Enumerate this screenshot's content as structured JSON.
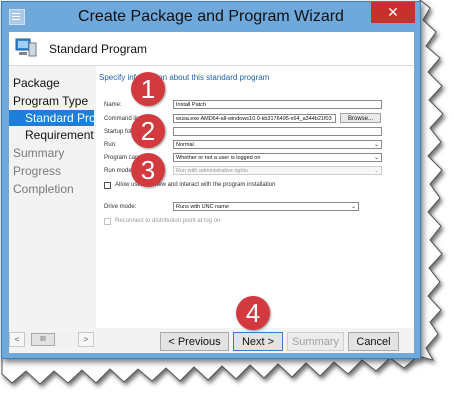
{
  "window": {
    "title": "Create Package and Program Wizard",
    "close_glyph": "✕"
  },
  "header": {
    "title": "Standard Program"
  },
  "nav": {
    "items": [
      {
        "label": "Package"
      },
      {
        "label": "Program Type"
      },
      {
        "label": "Standard Program",
        "selected": true
      },
      {
        "label": "Requirements"
      },
      {
        "label": "Summary"
      },
      {
        "label": "Progress"
      },
      {
        "label": "Completion"
      }
    ],
    "scroll_left": "<",
    "scroll_thumb": "III",
    "scroll_right": ">"
  },
  "content": {
    "heading": "Specify information about this standard program",
    "name_label": "Name:",
    "name_value": "Install Patch",
    "command_label": "Command line:",
    "command_value": "wusa.exe AMD64-all-windows10.0-kb3176495-x64_a344b21f03",
    "browse_label": "Browse...",
    "startup_label": "Startup folder:",
    "startup_value": "",
    "run_label": "Run:",
    "run_value": "Normal",
    "program_can_run_label": "Program can run:",
    "program_can_run_value": "Whether or not a user is logged on",
    "run_mode_label": "Run mode:",
    "run_mode_value": "Run with administrative rights",
    "allow_interact_label": "Allow users to view and interact with the program installation",
    "drive_mode_label": "Drive mode:",
    "drive_mode_value": "Runs with UNC name",
    "reconnect_label": "Reconnect to distribution point at log on"
  },
  "buttons": {
    "previous": "< Previous",
    "next": "Next >",
    "summary": "Summary",
    "cancel": "Cancel"
  },
  "callouts": [
    "1",
    "2",
    "3",
    "4"
  ],
  "colors": {
    "titlebar": "#6fa9dc",
    "close": "#c7302b",
    "selection": "#1e7fd8",
    "callout": "#d33a3f",
    "heading": "#1f62a8"
  }
}
